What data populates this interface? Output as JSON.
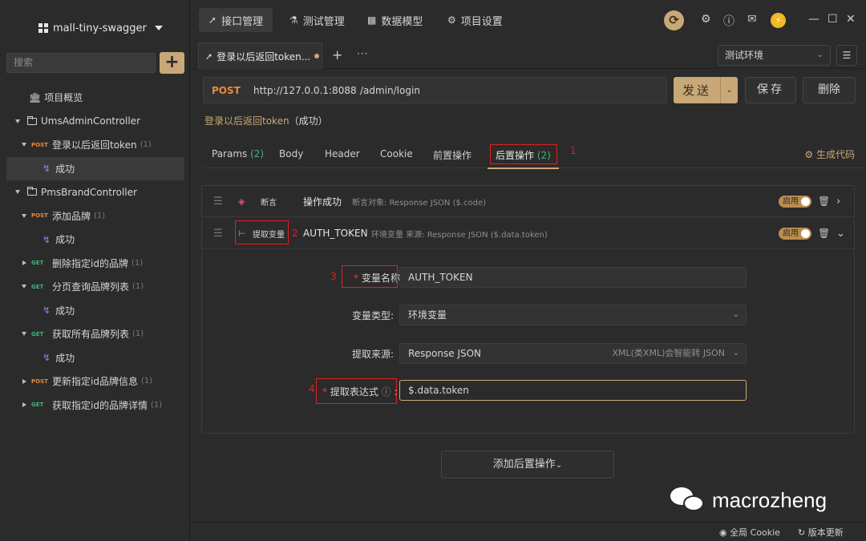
{
  "sidebar": {
    "project_name": "mall-tiny-swagger",
    "search_placeholder": "搜索",
    "add_label": "+",
    "overview": "项目概览",
    "tree": [
      {
        "type": "folder",
        "label": "UmsAdminController"
      },
      {
        "type": "api",
        "method": "POST",
        "label": "登录以后返回token",
        "count": "(1)"
      },
      {
        "type": "case",
        "label": "成功"
      },
      {
        "type": "folder",
        "label": "PmsBrandController"
      },
      {
        "type": "api",
        "method": "POST",
        "label": "添加品牌",
        "count": "(1)"
      },
      {
        "type": "case",
        "label": "成功"
      },
      {
        "type": "api",
        "method": "GET",
        "label": "删除指定id的品牌",
        "count": "(1)"
      },
      {
        "type": "api",
        "method": "GET",
        "label": "分页查询品牌列表",
        "count": "(1)"
      },
      {
        "type": "case",
        "label": "成功"
      },
      {
        "type": "api",
        "method": "GET",
        "label": "获取所有品牌列表",
        "count": "(1)"
      },
      {
        "type": "case",
        "label": "成功"
      },
      {
        "type": "api",
        "method": "POST",
        "label": "更新指定id品牌信息",
        "count": "(1)"
      },
      {
        "type": "api",
        "method": "GET",
        "label": "获取指定id的品牌详情",
        "count": "(1)"
      }
    ]
  },
  "header": {
    "tabs": [
      "接口管理",
      "测试管理",
      "数据模型",
      "项目设置"
    ]
  },
  "tabrow": {
    "tab_title": "登录以后返回token...",
    "env": "测试环境"
  },
  "request": {
    "method": "POST",
    "host": "http://127.0.0.1:8088",
    "path": "/admin/login",
    "send": "发送",
    "save": "保存",
    "delete": "删除",
    "name": "登录以后返回token",
    "case_suffix": "（成功）"
  },
  "subtabs": {
    "params": "Params",
    "params_count": "(2)",
    "body": "Body",
    "header": "Header",
    "cookie": "Cookie",
    "pre": "前置操作",
    "post": "后置操作",
    "post_count": "(2)",
    "gen_code": "生成代码"
  },
  "annotations": [
    "1",
    "2",
    "3",
    "4"
  ],
  "ops": {
    "assert_kind": "断言",
    "assert_name": "操作成功",
    "assert_desc": "断言对象: Response JSON ($.code)",
    "extract_kind": "提取变量",
    "extract_name": "AUTH_TOKEN",
    "extract_desc": "环境变量    来源: Response JSON ($.data.token)",
    "toggle": "启用"
  },
  "form": {
    "var_name_label": "变量名称:",
    "var_name": "AUTH_TOKEN",
    "var_type_label": "变量类型:",
    "var_type": "环境变量",
    "source_label": "提取来源:",
    "source": "Response JSON",
    "source_hint": "XML(类XML)会智能转 JSON",
    "expr_label": "提取表达式",
    "expr": "$.data.token"
  },
  "add_post": "添加后置操作",
  "watermark": "macrozheng",
  "status": {
    "cookie": "全局 Cookie",
    "update": "版本更新"
  }
}
